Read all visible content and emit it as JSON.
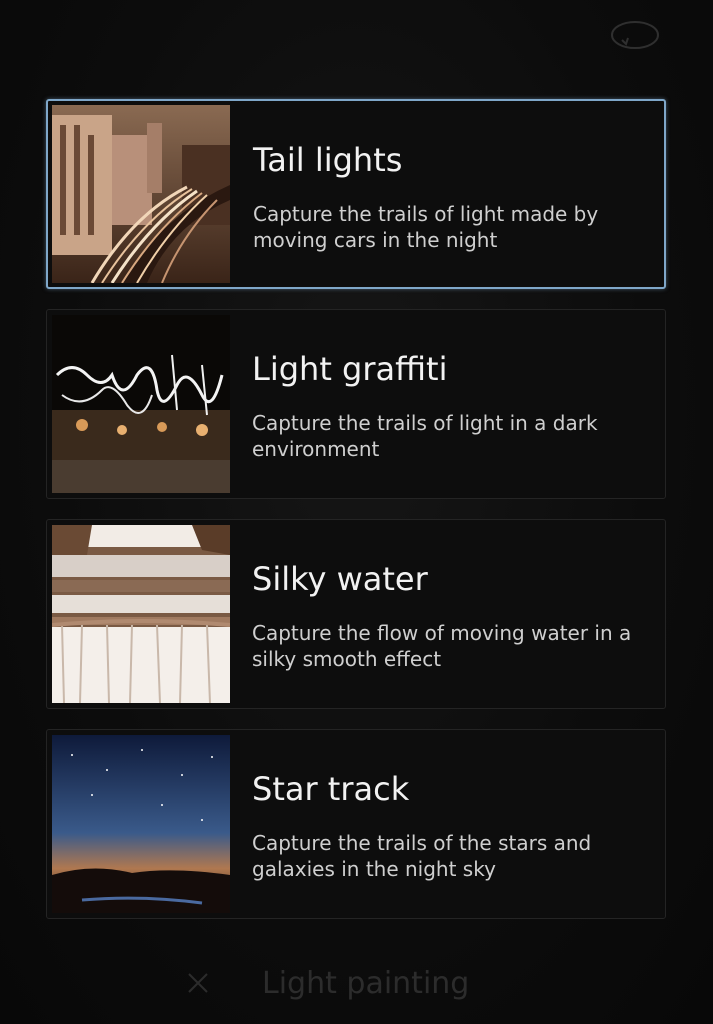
{
  "header": {
    "rotate_icon": "rotate-camera-icon"
  },
  "modes": [
    {
      "title": "Tail lights",
      "description": "Capture the trails of light made by moving cars in the night",
      "thumbnail": "city-street-light-trails",
      "selected": true
    },
    {
      "title": "Light graffiti",
      "description": "Capture the trails of light in a dark environment",
      "thumbnail": "light-writing-night",
      "selected": false
    },
    {
      "title": "Silky water",
      "description": "Capture the flow of moving water in a silky smooth effect",
      "thumbnail": "waterfall",
      "selected": false
    },
    {
      "title": "Star track",
      "description": "Capture the trails of the stars and galaxies in the night sky",
      "thumbnail": "starry-night-sky",
      "selected": false
    }
  ],
  "footer": {
    "close_icon": "close-icon",
    "title": "Light painting"
  },
  "colors": {
    "background": "#0b0b0b",
    "selected_border": "#7fa7c9",
    "title_text": "#f2f2f2",
    "description_text": "#cfcfcf"
  }
}
